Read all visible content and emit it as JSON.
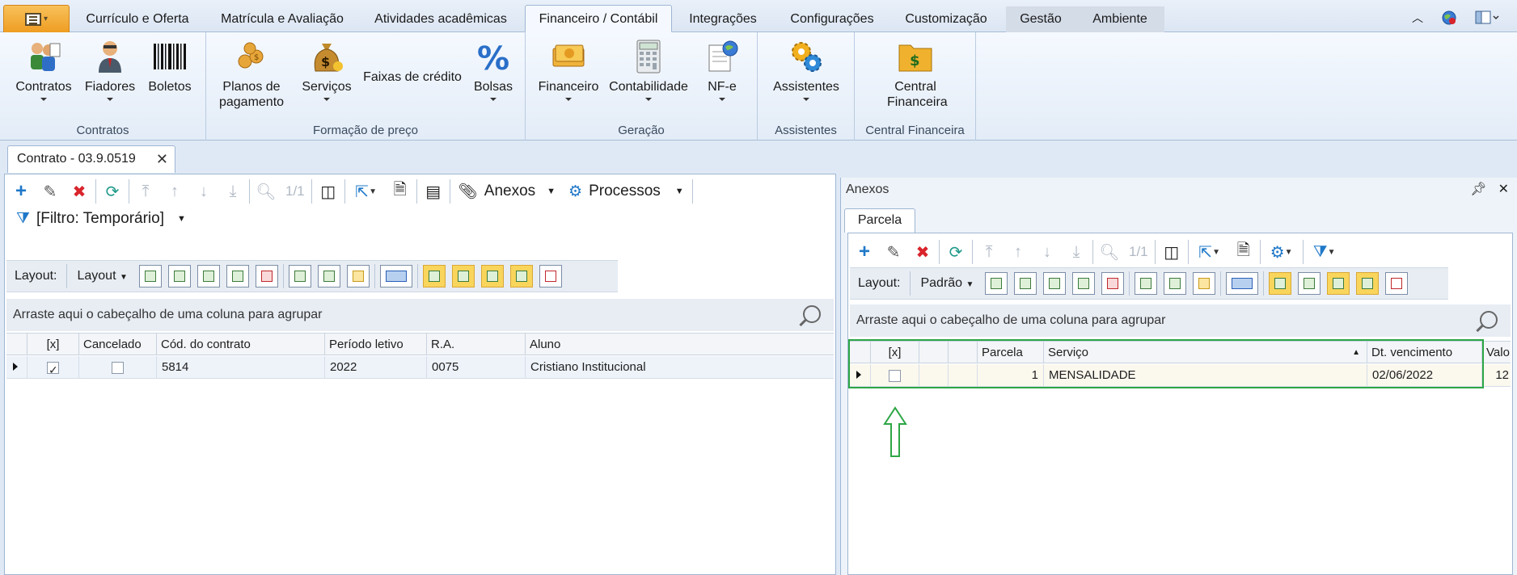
{
  "ribbon_tabs": [
    {
      "label": "Currículo e Oferta"
    },
    {
      "label": "Matrícula e Avaliação"
    },
    {
      "label": "Atividades acadêmicas"
    },
    {
      "label": "Financeiro / Contábil"
    },
    {
      "label": "Integrações"
    },
    {
      "label": "Configurações"
    },
    {
      "label": "Customização"
    },
    {
      "label": "Gestão"
    },
    {
      "label": "Ambiente"
    }
  ],
  "ribbon": {
    "groups": [
      {
        "caption": "Contratos",
        "buttons": [
          "Contratos",
          "Fiadores",
          "Boletos"
        ]
      },
      {
        "caption": "Formação de preço",
        "buttons": [
          "Planos de pagamento",
          "Serviços",
          "Faixas de crédito",
          "Bolsas"
        ]
      },
      {
        "caption": "Geração",
        "buttons": [
          "Financeiro",
          "Contabilidade",
          "NF-e"
        ]
      },
      {
        "caption": "Assistentes",
        "buttons": [
          "Assistentes"
        ]
      },
      {
        "caption": "Central Financeira",
        "buttons": [
          "Central Financeira"
        ]
      }
    ]
  },
  "doc_tab": {
    "label": "Contrato - 03.9.0519"
  },
  "left": {
    "record_counter": "1/1",
    "anexos_label": "Anexos",
    "processos_label": "Processos",
    "filter_label": "[Filtro: Temporário]",
    "layout_label": "Layout:",
    "layout_dropdown": "Layout",
    "group_hint": "Arraste aqui o cabeçalho de uma coluna para agrupar",
    "columns": [
      "[x]",
      "Cancelado",
      "Cód. do contrato",
      "Período letivo",
      "R.A.",
      "Aluno"
    ],
    "rows": [
      {
        "checked": true,
        "cancelado": false,
        "cod": "5814",
        "periodo": "2022",
        "ra": "0075",
        "aluno": "Cristiano Institucional"
      }
    ]
  },
  "right": {
    "panel_title": "Anexos",
    "sub_tab": "Parcela",
    "record_counter": "1/1",
    "layout_label": "Layout:",
    "layout_dropdown": "Padrão",
    "group_hint": "Arraste aqui o cabeçalho de uma coluna para agrupar",
    "columns": [
      "[x]",
      "",
      "",
      "Parcela",
      "Serviço",
      "Dt. vencimento",
      "Valo"
    ],
    "rows": [
      {
        "checked": false,
        "parcela": "1",
        "servico": "MENSALIDADE",
        "vencimento": "02/06/2022",
        "valor": "12"
      }
    ]
  },
  "colors": {
    "accent_orange": "#ef9d22",
    "highlight_green": "#2da645",
    "delete_red": "#d9242b",
    "action_blue": "#1f78c8"
  }
}
